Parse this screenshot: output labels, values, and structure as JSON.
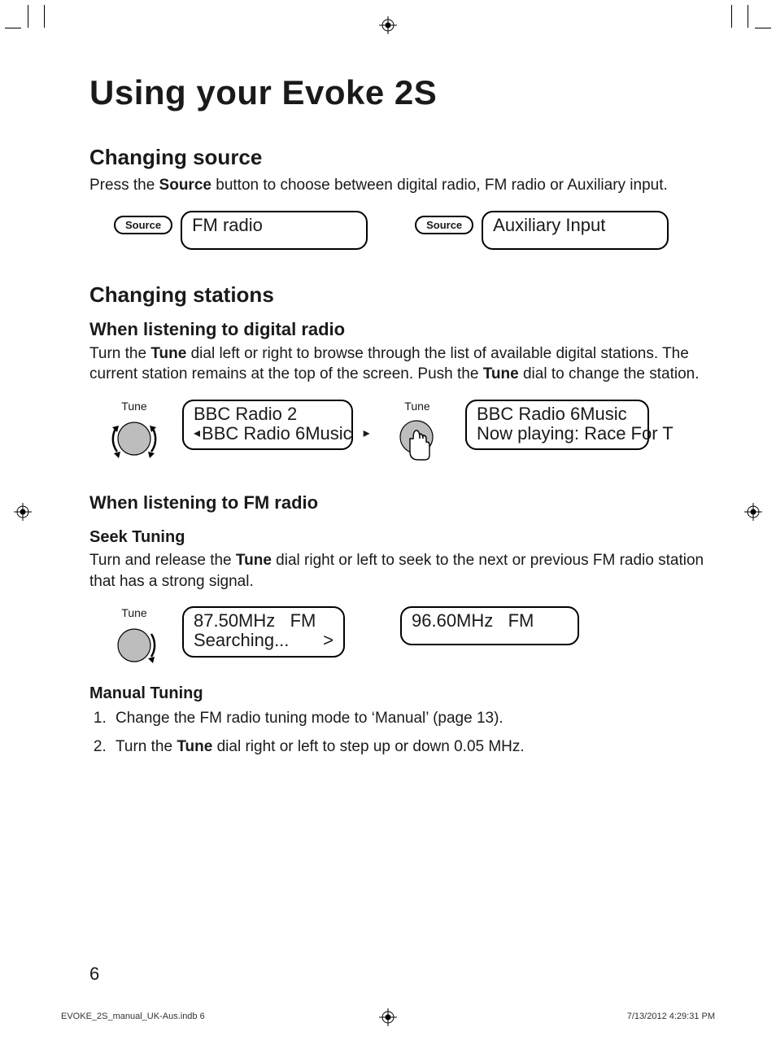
{
  "h1": "Using your Evoke 2S",
  "sec1": {
    "title": "Changing source",
    "para_pre": "Press the ",
    "para_bold": "Source",
    "para_post": " button to choose between digital radio, FM radio or Auxiliary input.",
    "btn_label": "Source",
    "lcd1": "FM radio",
    "lcd2": "Auxiliary Input"
  },
  "sec2": {
    "title": "Changing stations",
    "digital": {
      "title": "When listening to digital radio",
      "para_a": "Turn the ",
      "para_b": "Tune",
      "para_c": " dial left or right to browse through the list of available digital stations. The current station remains at the top of the screen. Push the ",
      "para_d": "Tune",
      "para_e": " dial to change the station.",
      "dial_label": "Tune",
      "lcd_a_l1": "BBC Radio 2",
      "lcd_a_l2": "BBC Radio 6Music",
      "lcd_b_l1": "BBC Radio 6Music",
      "lcd_b_l2": "Now playing: Race For T"
    },
    "fm": {
      "title": "When listening to FM radio",
      "seek": {
        "title": "Seek Tuning",
        "para_a": "Turn and release the ",
        "para_b": "Tune",
        "para_c": " dial right or left to seek to the next or previous FM radio station that has a strong signal.",
        "dial_label": "Tune",
        "lcd_a_l1": "87.50MHz   FM",
        "lcd_a_l2": "Searching...",
        "lcd_b_l1": "96.60MHz   FM"
      },
      "manual": {
        "title": "Manual Tuning",
        "step1": "Change the FM radio tuning mode to ‘Manual’ (page 13).",
        "step2_a": "Turn the ",
        "step2_b": "Tune",
        "step2_c": " dial right or left to step up or down 0.05 MHz."
      }
    }
  },
  "page_number": "6",
  "footer_left": "EVOKE_2S_manual_UK-Aus.indb   6",
  "footer_right": "7/13/2012   4:29:31 PM"
}
